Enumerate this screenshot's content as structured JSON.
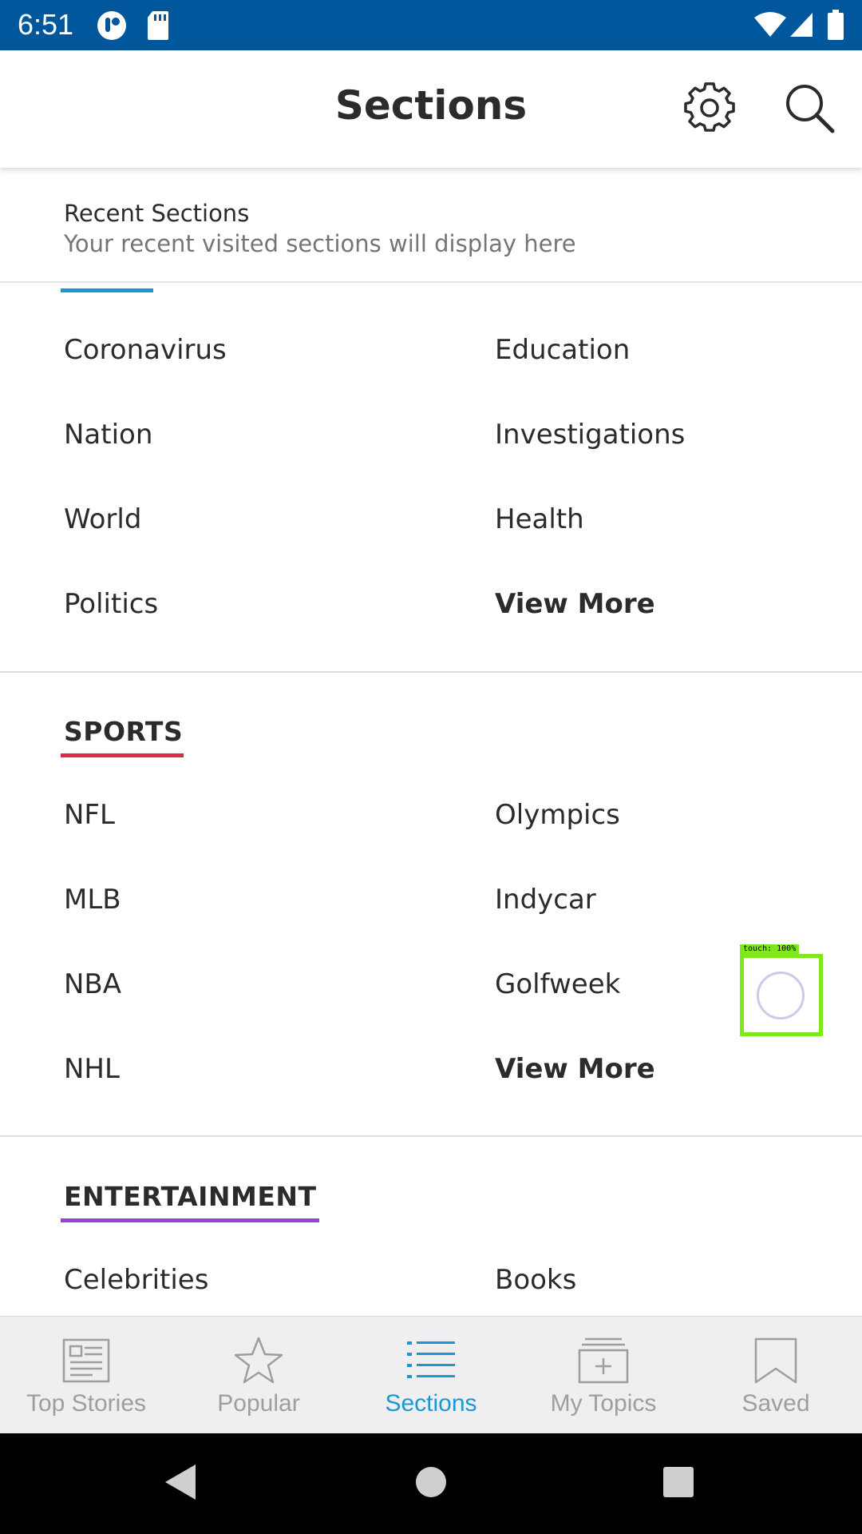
{
  "status_bar": {
    "time": "6:51",
    "icons": [
      "app-notification-icon",
      "sd-card-icon",
      "wifi-icon",
      "signal-icon",
      "battery-icon"
    ]
  },
  "app_bar": {
    "title": "Sections",
    "actions": [
      "gear-icon",
      "search-icon"
    ]
  },
  "recent": {
    "title": "Recent Sections",
    "subtitle": "Your recent visited sections will display here"
  },
  "news": {
    "accent": "#1a97d5",
    "left": [
      "Coronavirus",
      "Nation",
      "World",
      "Politics"
    ],
    "right": [
      "Education",
      "Investigations",
      "Health"
    ],
    "view_more": "View More"
  },
  "sports": {
    "title": "SPORTS",
    "accent": "#e0284b",
    "left": [
      "NFL",
      "MLB",
      "NBA",
      "NHL"
    ],
    "right": [
      "Olympics",
      "Indycar",
      "Golfweek"
    ],
    "view_more": "View More"
  },
  "entertainment": {
    "title": "ENTERTAINMENT",
    "accent": "#9b42d6",
    "left": [
      "Celebrities"
    ],
    "right": [
      "Books"
    ]
  },
  "touch_overlay": {
    "label": "touch: 100%"
  },
  "bottom_nav": {
    "active_color": "#1a97d5",
    "inactive_color": "#9e9e9e",
    "items": [
      {
        "label": "Top Stories",
        "icon": "newspaper-icon"
      },
      {
        "label": "Popular",
        "icon": "star-icon"
      },
      {
        "label": "Sections",
        "icon": "list-icon",
        "active": true
      },
      {
        "label": "My Topics",
        "icon": "add-topic-icon"
      },
      {
        "label": "Saved",
        "icon": "bookmark-icon"
      }
    ]
  },
  "system_nav": [
    "back-icon",
    "home-icon",
    "recents-icon"
  ]
}
